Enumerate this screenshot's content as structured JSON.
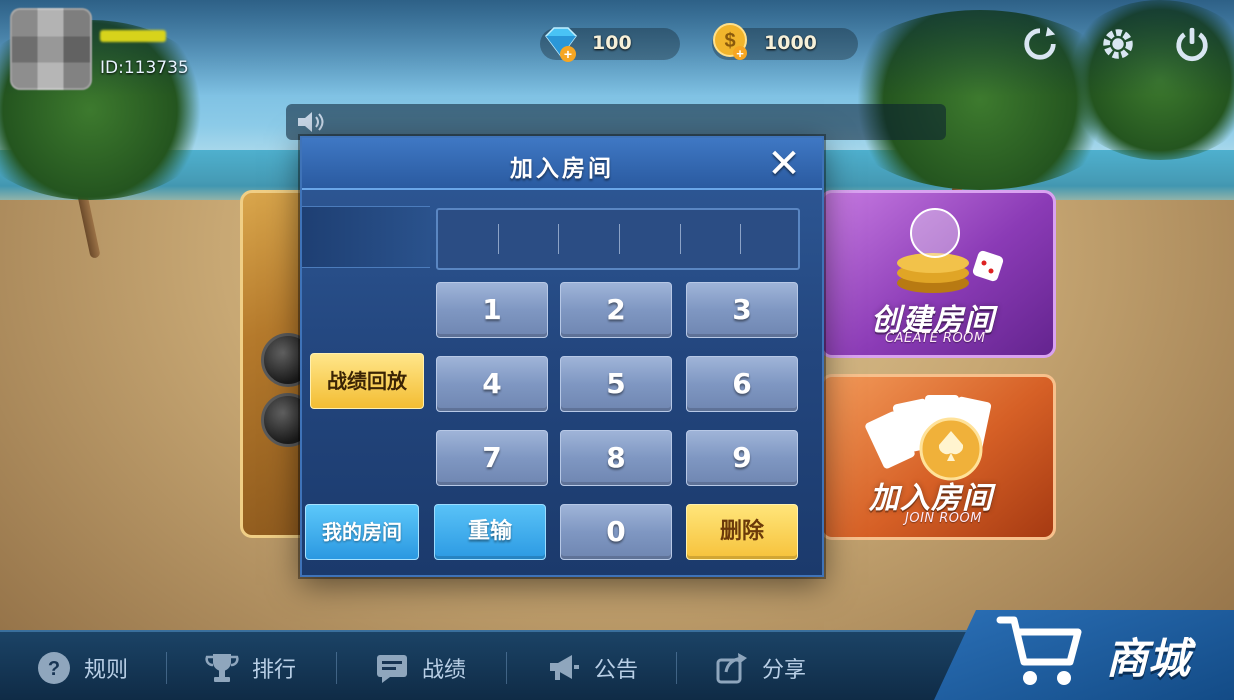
{
  "user": {
    "id_text": "ID:113735"
  },
  "currency": {
    "diamonds": "100",
    "coins": "1000"
  },
  "modal": {
    "title": "加入房间",
    "keys": [
      "1",
      "2",
      "3",
      "4",
      "5",
      "6",
      "7",
      "8",
      "9"
    ],
    "zero": "0",
    "reset_label": "重输",
    "delete_label": "删除"
  },
  "side_buttons": {
    "record": "战绩回放",
    "my_room": "我的房间"
  },
  "cards": {
    "create": {
      "title": "创建房间",
      "sub": "CAEATE ROOM"
    },
    "join": {
      "title": "加入房间",
      "sub": "JOIN ROOM"
    }
  },
  "bottom_nav": {
    "rules": "规则",
    "ranking": "排行",
    "record": "战绩",
    "notice": "公告",
    "share": "分享",
    "shop": "商城"
  },
  "icons": [
    "diamond-icon",
    "coin-icon",
    "refresh-icon",
    "gear-icon",
    "power-icon",
    "speaker-icon",
    "close-icon",
    "help-icon",
    "trophy-icon",
    "message-icon",
    "megaphone-icon",
    "share-icon",
    "cart-icon"
  ],
  "colors": {
    "modal_bg": "#23467e",
    "key_blue": "#7f97c2",
    "accent_yellow": "#f6c23b",
    "accent_cyan": "#2c9ae3"
  }
}
